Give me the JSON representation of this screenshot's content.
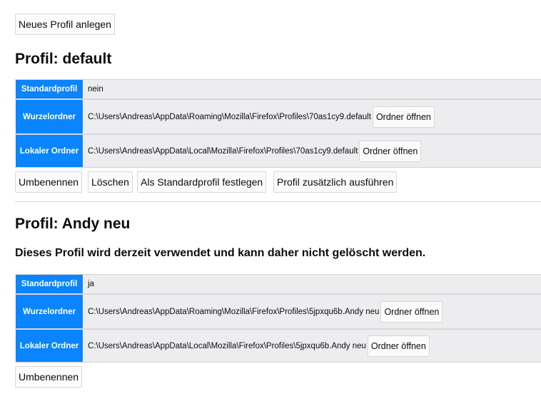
{
  "new_profile_button": "Neues Profil anlegen",
  "profiles": [
    {
      "title": "Profil: default",
      "rows": [
        {
          "label": "Standardprofil",
          "value": "nein"
        },
        {
          "label": "Wurzelordner",
          "value": "C:\\Users\\Andreas\\AppData\\Roaming\\Mozilla\\Firefox\\Profiles\\70as1cy9.default",
          "button": "Ordner öffnen"
        },
        {
          "label": "Lokaler Ordner",
          "value": "C:\\Users\\Andreas\\AppData\\Local\\Mozilla\\Firefox\\Profiles\\70as1cy9.default",
          "button": "Ordner öffnen"
        }
      ],
      "actions": {
        "rename": "Umbenennen",
        "delete": "Löschen",
        "set_default": "Als Standardprofil festlegen",
        "launch": "Profil zusätzlich ausführen"
      }
    },
    {
      "title": "Profil: Andy neu",
      "notice": "Dieses Profil wird derzeit verwendet und kann daher nicht gelöscht werden.",
      "rows": [
        {
          "label": "Standardprofil",
          "value": "ja"
        },
        {
          "label": "Wurzelordner",
          "value": "C:\\Users\\Andreas\\AppData\\Roaming\\Mozilla\\Firefox\\Profiles\\5jpxqu6b.Andy neu",
          "button": "Ordner öffnen"
        },
        {
          "label": "Lokaler Ordner",
          "value": "C:\\Users\\Andreas\\AppData\\Local\\Mozilla\\Firefox\\Profiles\\5jpxqu6b.Andy neu",
          "button": "Ordner öffnen"
        }
      ],
      "actions": {
        "rename": "Umbenennen"
      }
    }
  ],
  "colors": {
    "header_cell": "#0a84ff",
    "row_background": "#ededf0",
    "button_border": "#d7d7db"
  }
}
